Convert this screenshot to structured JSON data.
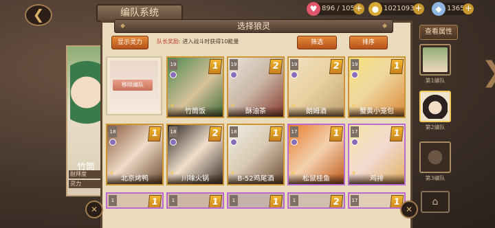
{
  "window": {
    "title": "编队系统"
  },
  "resources": [
    {
      "icon": "heart-icon",
      "value": "896 / 105",
      "color": "#e0566a"
    },
    {
      "icon": "coin-icon",
      "value": "1021093",
      "color": "#d6a935"
    },
    {
      "icon": "crystal-icon",
      "value": "1365",
      "color": "#8fb6e0"
    }
  ],
  "panel": {
    "title": "选择狼灵",
    "show_spirit_button": "显示灵力",
    "reward_label": "队长奖励:",
    "reward_text": "进入战斗时获得10能量",
    "filter_button": "筛选",
    "sort_button": "排序",
    "remove_button": "移除编队"
  },
  "cards": [
    {
      "name": "竹筒饭",
      "level": "19",
      "cost": "1",
      "border": "gold"
    },
    {
      "name": "酥油茶",
      "level": "19",
      "cost": "2",
      "border": "gold"
    },
    {
      "name": "朗姆酒",
      "level": "19",
      "cost": "2",
      "border": "gold"
    },
    {
      "name": "蟹黄小笼包",
      "level": "19",
      "cost": "1",
      "border": "gold"
    },
    {
      "name": "北京烤鸭",
      "level": "18",
      "cost": "1",
      "border": "gold"
    },
    {
      "name": "川味火锅",
      "level": "18",
      "cost": "2",
      "border": "gold"
    },
    {
      "name": "B-52鸡尾酒",
      "level": "18",
      "cost": "1",
      "border": "gold"
    },
    {
      "name": "松鼠桂鱼",
      "level": "17",
      "cost": "1",
      "border": "purple"
    },
    {
      "name": "鸡排",
      "level": "17",
      "cost": "1",
      "border": "purple"
    }
  ],
  "stub_row": [
    {
      "level": "1",
      "cost": "1"
    },
    {
      "level": "1",
      "cost": "1"
    },
    {
      "level": "1",
      "cost": "1"
    },
    {
      "level": "1",
      "cost": "2"
    },
    {
      "level": "17",
      "cost": "1"
    }
  ],
  "left_card": {
    "name": "竹筒",
    "stats": [
      "耐拜度",
      "灵力"
    ]
  },
  "right": {
    "attr_button": "查看属性",
    "teams": [
      "第1编队",
      "第2编队",
      "第3编队"
    ]
  }
}
